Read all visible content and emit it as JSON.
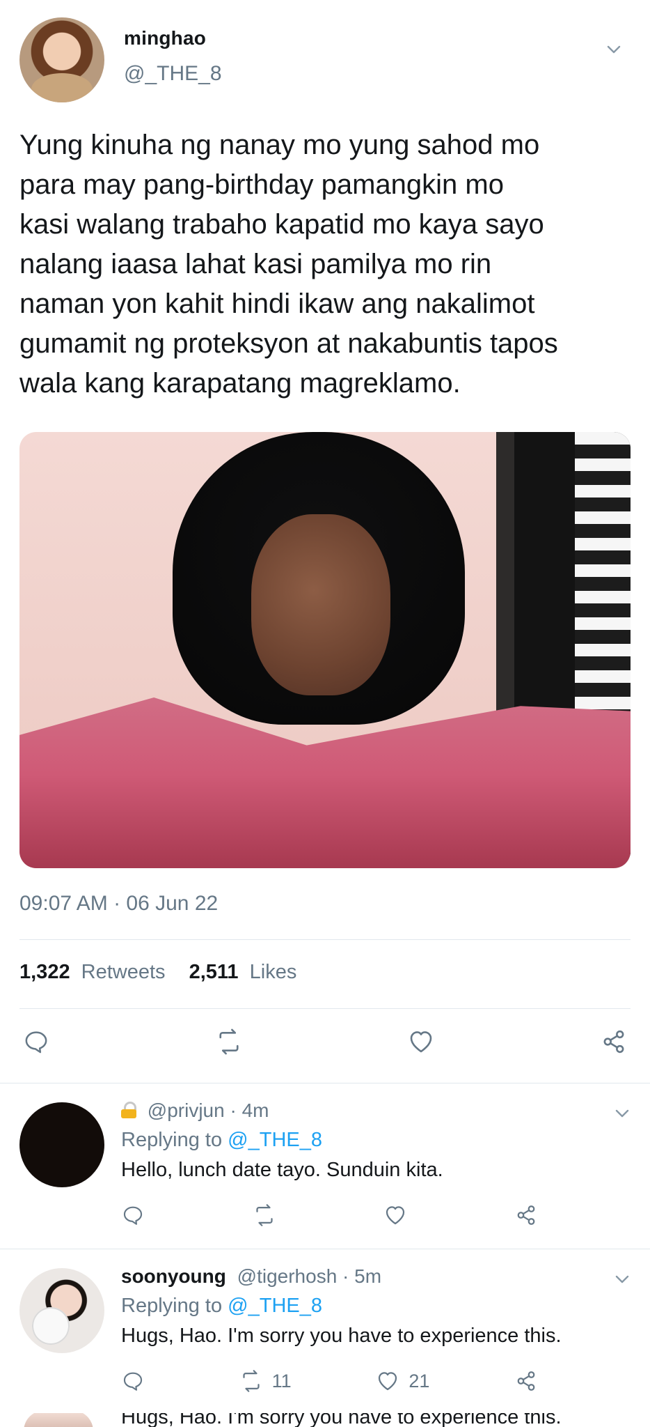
{
  "main_tweet": {
    "user": {
      "name": "minghao",
      "handle": "@_THE_8",
      "avatar_icon": "profile-photo"
    },
    "text": "Yung kinuha ng nanay mo yung sahod mo\npara may pang-birthday pamangkin mo\nkasi walang trabaho kapatid mo kaya sayo\nnalang iaasa lahat kasi pamilya mo rin\nnaman yon kahit hindi ikaw ang nakalimot\ngumamit ng proteksyon at nakabuntis tapos\nwala kang karapatang magreklamo.",
    "timestamp": "09:07 AM · 06 Jun 22",
    "stats": {
      "retweets_count": "1,322",
      "retweets_label": "Retweets",
      "likes_count": "2,511",
      "likes_label": "Likes"
    },
    "actions": [
      {
        "name": "reply",
        "icon": "reply-icon"
      },
      {
        "name": "retweet",
        "icon": "retweet-icon"
      },
      {
        "name": "like",
        "icon": "heart-icon"
      },
      {
        "name": "share",
        "icon": "share-icon"
      }
    ]
  },
  "replies": [
    {
      "protected": true,
      "name": "",
      "handle": "@privjun",
      "time": "4m",
      "replying_prefix": "Replying to",
      "replying_to": "@_THE_8",
      "text": "Hello, lunch date tayo. Sunduin kita.",
      "counts": {
        "reply": "",
        "retweet": "",
        "like": ""
      }
    },
    {
      "protected": false,
      "name": "soonyoung",
      "handle": "@tigerhosh",
      "time": "5m",
      "replying_prefix": "Replying to",
      "replying_to": "@_THE_8",
      "text": "Hugs, Hao. I'm sorry you have to experience this.",
      "counts": {
        "reply": "",
        "retweet": "11",
        "like": "21"
      }
    }
  ],
  "partial_next_reply": {
    "text": "Hugs, Hao. I'm sorry you have to experience this."
  },
  "colors": {
    "text_primary": "#14171a",
    "text_secondary": "#657786",
    "link": "#1da1f2",
    "divider": "#e1e8ed",
    "lock": "#f2b31d"
  }
}
